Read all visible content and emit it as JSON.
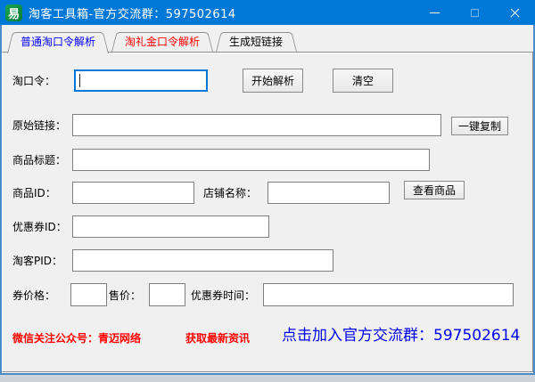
{
  "window": {
    "title": "淘客工具箱-官方交流群：597502614",
    "app_icon_text": "易",
    "controls": {
      "minimize": "minimize",
      "maximize": "maximize",
      "close": "close"
    }
  },
  "tabs": [
    {
      "label": "普通淘口令解析",
      "text_color": "#0000ff",
      "active": true
    },
    {
      "label": "淘礼金口令解析",
      "text_color": "#ff0000",
      "active": false
    },
    {
      "label": "生成短链接",
      "text_color": "#000000",
      "active": false
    }
  ],
  "form": {
    "taokouling": {
      "label": "淘口令：",
      "value": ""
    },
    "original_link": {
      "label": "原始链接：",
      "value": ""
    },
    "product_title": {
      "label": "商品标题：",
      "value": ""
    },
    "product_id": {
      "label": "商品ID：",
      "value": ""
    },
    "shop_name": {
      "label": "店铺名称：",
      "value": ""
    },
    "coupon_id": {
      "label": "优惠券ID：",
      "value": ""
    },
    "taoke_pid": {
      "label": "淘客PID：",
      "value": ""
    },
    "coupon_price": {
      "label": "券价格：",
      "value": ""
    },
    "sale_price": {
      "label": "售价：",
      "value": ""
    },
    "coupon_time": {
      "label": "优惠券时间：",
      "value": ""
    },
    "buttons": {
      "parse": "开始解析",
      "clear": "清空",
      "copy": "一键复制",
      "view_product": "查看商品"
    }
  },
  "footer": {
    "wechat_text": "微信关注公众号：青迈网络",
    "news_text": "获取最新资讯",
    "group_text": "点击加入官方交流群：597502614",
    "red_color": "#ff0000",
    "blue_color": "#0000ee"
  },
  "colors": {
    "titlebar": "#0078d7",
    "window_border": "#4a8cc7",
    "panel_background": "#f0f0f0",
    "focused_input_border": "#0078d7",
    "active_tab_text": "#0000ff",
    "second_tab_text": "#ff0000",
    "icon_green": "#128e43"
  }
}
